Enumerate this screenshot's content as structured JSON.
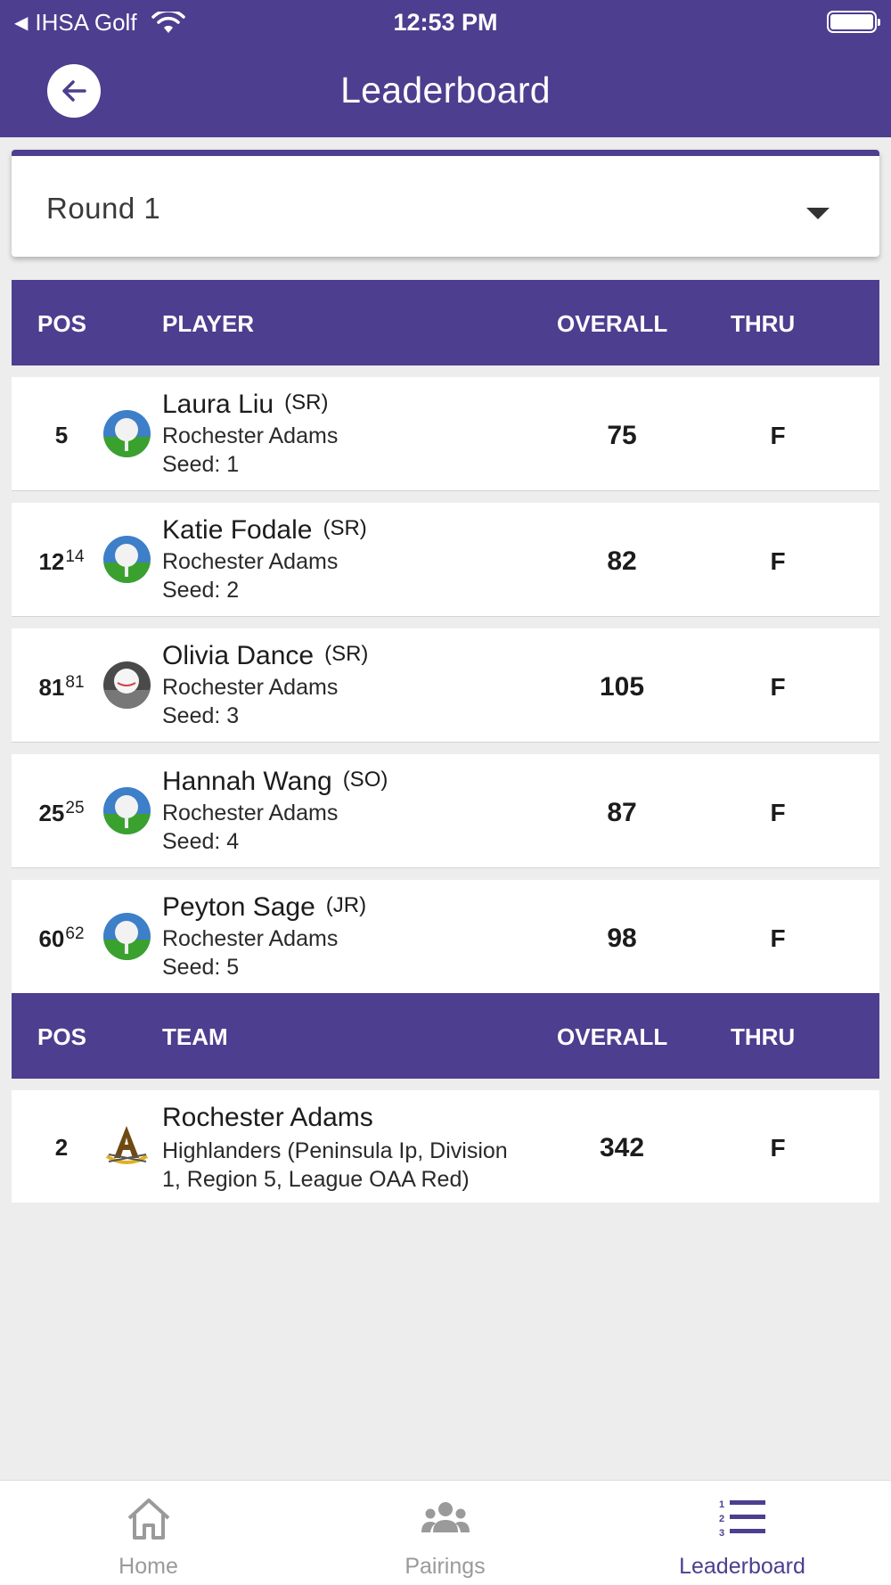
{
  "status_bar": {
    "back_app": "IHSA Golf",
    "time": "12:53 PM"
  },
  "header": {
    "title": "Leaderboard"
  },
  "round_select": {
    "value": "Round 1"
  },
  "player_table": {
    "headers": {
      "pos": "POS",
      "player": "PLAYER",
      "overall": "OVERALL",
      "thru": "THRU"
    },
    "rows": [
      {
        "pos": "5",
        "pos_prev": "",
        "name": "Laura Liu",
        "class": "(SR)",
        "school": "Rochester Adams",
        "seed": "Seed: 1",
        "overall": "75",
        "thru": "F"
      },
      {
        "pos": "12",
        "pos_prev": "14",
        "name": "Katie Fodale",
        "class": "(SR)",
        "school": "Rochester Adams",
        "seed": "Seed: 2",
        "overall": "82",
        "thru": "F"
      },
      {
        "pos": "81",
        "pos_prev": "81",
        "name": "Olivia Dance",
        "class": "(SR)",
        "school": "Rochester Adams",
        "seed": "Seed: 3",
        "overall": "105",
        "thru": "F"
      },
      {
        "pos": "25",
        "pos_prev": "25",
        "name": "Hannah Wang",
        "class": "(SO)",
        "school": "Rochester Adams",
        "seed": "Seed: 4",
        "overall": "87",
        "thru": "F"
      },
      {
        "pos": "60",
        "pos_prev": "62",
        "name": "Peyton Sage",
        "class": "(JR)",
        "school": "Rochester Adams",
        "seed": "Seed: 5",
        "overall": "98",
        "thru": "F"
      }
    ]
  },
  "team_table": {
    "headers": {
      "pos": "POS",
      "team": "TEAM",
      "overall": "OVERALL",
      "thru": "THRU"
    },
    "rows": [
      {
        "pos": "2",
        "name": "Rochester Adams",
        "sub_line1": "Highlanders (Peninsula Ip, Division",
        "sub_line2": "1, Region 5, League OAA Red)",
        "overall": "342",
        "thru": "F"
      }
    ]
  },
  "bottom_nav": {
    "items": [
      {
        "label": "Home",
        "icon": "home-icon",
        "active": false
      },
      {
        "label": "Pairings",
        "icon": "people-icon",
        "active": false
      },
      {
        "label": "Leaderboard",
        "icon": "leaderboard-list-icon",
        "active": true
      }
    ]
  },
  "colors": {
    "primary": "#4d3e8f",
    "background": "#ededed",
    "inactive": "#9a9a9a"
  }
}
